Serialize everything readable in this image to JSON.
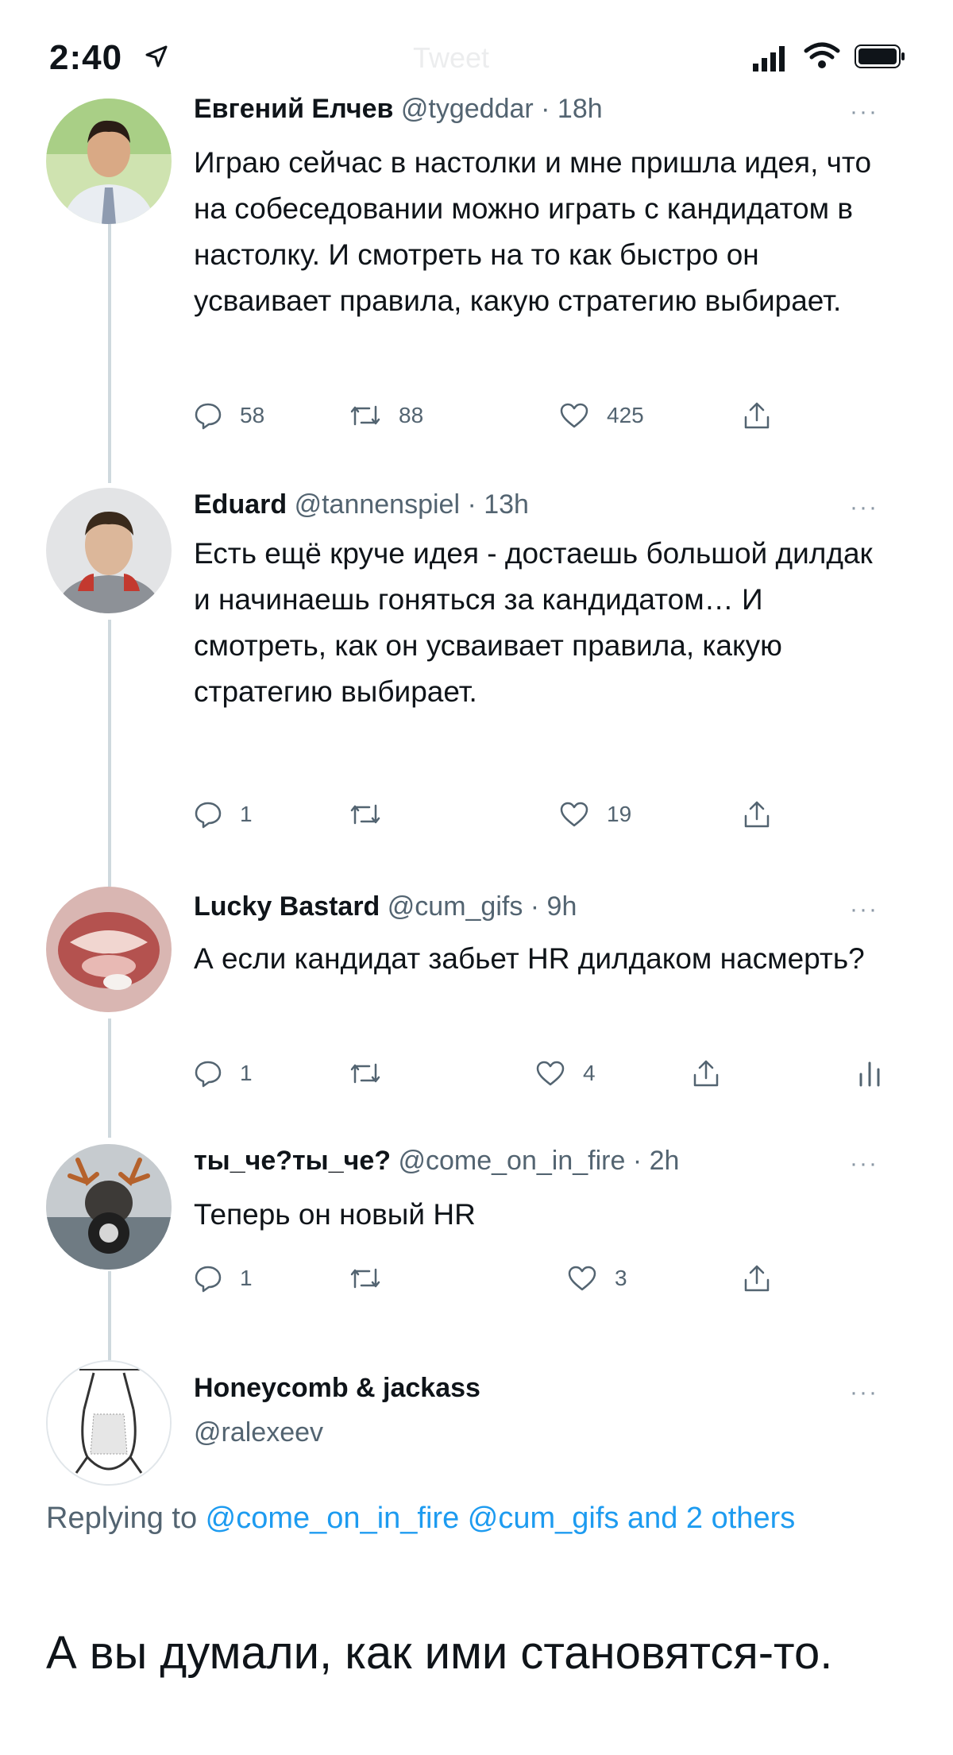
{
  "status_bar": {
    "time": "2:40",
    "faded_title": "Tweet"
  },
  "tweets": [
    {
      "name": "Евгений Елчев",
      "handle": "@tygeddar · 18h",
      "text": "Играю сейчас в настолки и мне пришла идея, что на собеседовании можно играть с кандидатом в настолку. И смотреть на то как быстро он усваивает правила, какую стратегию выбирает.",
      "replies": "58",
      "retweets": "88",
      "likes": "425"
    },
    {
      "name": "Eduard",
      "handle": "@tannenspiel · 13h",
      "text": "Есть ещё круче идея - достаешь большой дилдак и начинаешь гоняться за кандидатом… И смотреть, как он усваивает правила, какую стратегию выбирает.",
      "replies": "1",
      "retweets": "",
      "likes": "19"
    },
    {
      "name": "Lucky Bastard",
      "handle": "@cum_gifs · 9h",
      "text": "А если кандидат забьет HR дилдаком насмерть?",
      "replies": "1",
      "retweets": "",
      "likes": "4"
    },
    {
      "name": "ты_че?ты_че?",
      "handle": "@come_on_in_fire · 2h",
      "text": "Теперь он новый HR",
      "replies": "1",
      "retweets": "",
      "likes": "3"
    }
  ],
  "main_tweet": {
    "name": "Honeycomb & jackass",
    "handle": "@ralexeev",
    "replying_prefix": "Replying to ",
    "replying_link1": "@come_on_in_fire",
    "replying_link2": "@cum_gifs",
    "replying_link3": "and 2 others",
    "text": "А вы думали, как ими становятся-то."
  },
  "more_glyph": "···",
  "colors": {
    "accent": "#1d9bf0",
    "muted": "#536471",
    "line": "#cfd9de"
  }
}
